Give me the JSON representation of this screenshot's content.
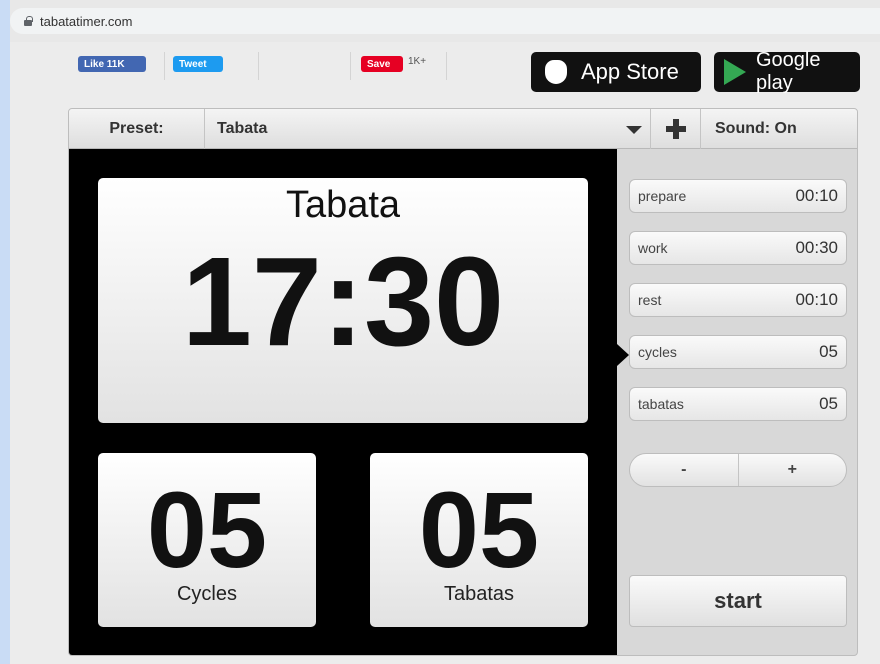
{
  "browser": {
    "url": "tabatatimer.com"
  },
  "social": {
    "facebook_label": "Like 11K",
    "tweet_label": "Tweet",
    "pinterest_label": "Save",
    "pinterest_count": "1K+"
  },
  "stores": {
    "appstore_label": "App Store",
    "googleplay_label": "Google play"
  },
  "toolbar": {
    "preset_label": "Preset:",
    "preset_value": "Tabata",
    "sound_label": "Sound: On"
  },
  "display": {
    "title": "Tabata",
    "time": "17:30",
    "cycles_value": "05",
    "cycles_label": "Cycles",
    "tabatas_value": "05",
    "tabatas_label": "Tabatas"
  },
  "settings": {
    "fields": [
      {
        "label": "prepare",
        "value": "00:10"
      },
      {
        "label": "work",
        "value": "00:30"
      },
      {
        "label": "rest",
        "value": "00:10"
      },
      {
        "label": "cycles",
        "value": "05"
      },
      {
        "label": "tabatas",
        "value": "05"
      }
    ],
    "selected_field": "cycles",
    "minus_label": "-",
    "plus_label": "+",
    "start_label": "start"
  }
}
